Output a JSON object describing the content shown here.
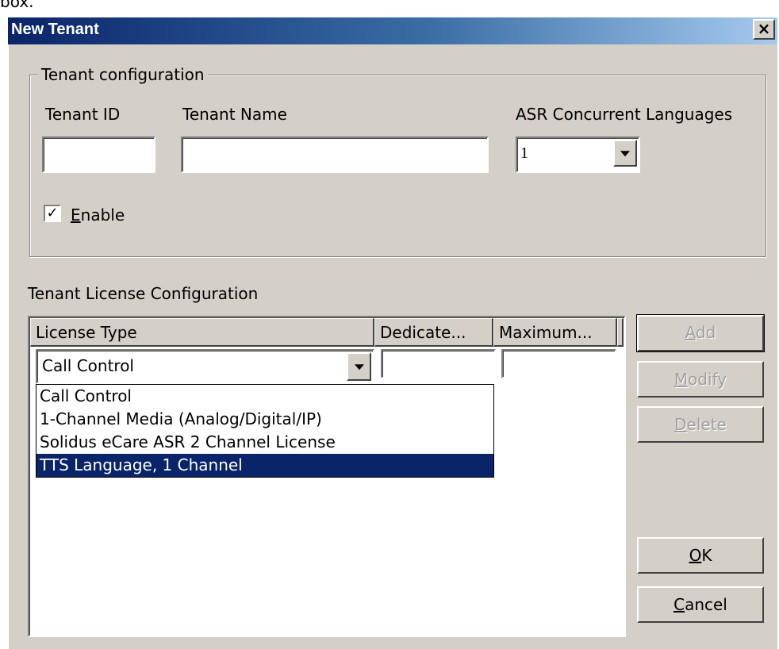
{
  "caption_fragment": "box.",
  "window": {
    "title": "New Tenant",
    "close_symbol": "×"
  },
  "tenant_config": {
    "group_label": "Tenant configuration",
    "tenant_id_label": "Tenant ID",
    "tenant_id_value": "",
    "tenant_name_label": "Tenant Name",
    "tenant_name_value": "",
    "asr_label": "ASR Concurrent Languages",
    "asr_value": "1",
    "enable_checked": true,
    "enable_label_mnemonic": "E",
    "enable_label_rest": "nable"
  },
  "license": {
    "section_label": "Tenant License Configuration",
    "columns": [
      "License Type",
      "Dedicate...",
      "Maximum..."
    ],
    "edit_row": {
      "license_type": "Call Control",
      "dedicated": "",
      "maximum": ""
    },
    "dropdown_options": [
      "Call Control",
      "1-Channel Media (Analog/Digital/IP)",
      "Solidus eCare ASR 2 Channel License",
      "TTS Language, 1 Channel"
    ],
    "dropdown_selected_index": 3
  },
  "buttons": {
    "add": {
      "mnemonic": "A",
      "rest": "dd",
      "enabled": false
    },
    "modify": {
      "mnemonic": "M",
      "rest": "odify",
      "enabled": false
    },
    "delete": {
      "mnemonic": "D",
      "rest": "elete",
      "enabled": false
    },
    "ok": {
      "mnemonic": "O",
      "rest": "K",
      "enabled": true
    },
    "cancel": {
      "mnemonic": "C",
      "rest": "ancel",
      "enabled": true
    }
  },
  "colors": {
    "dialog_bg": "#d4d0c8",
    "selection": "#0a246a",
    "title_start": "#0a246a",
    "title_end": "#a6caf0"
  }
}
